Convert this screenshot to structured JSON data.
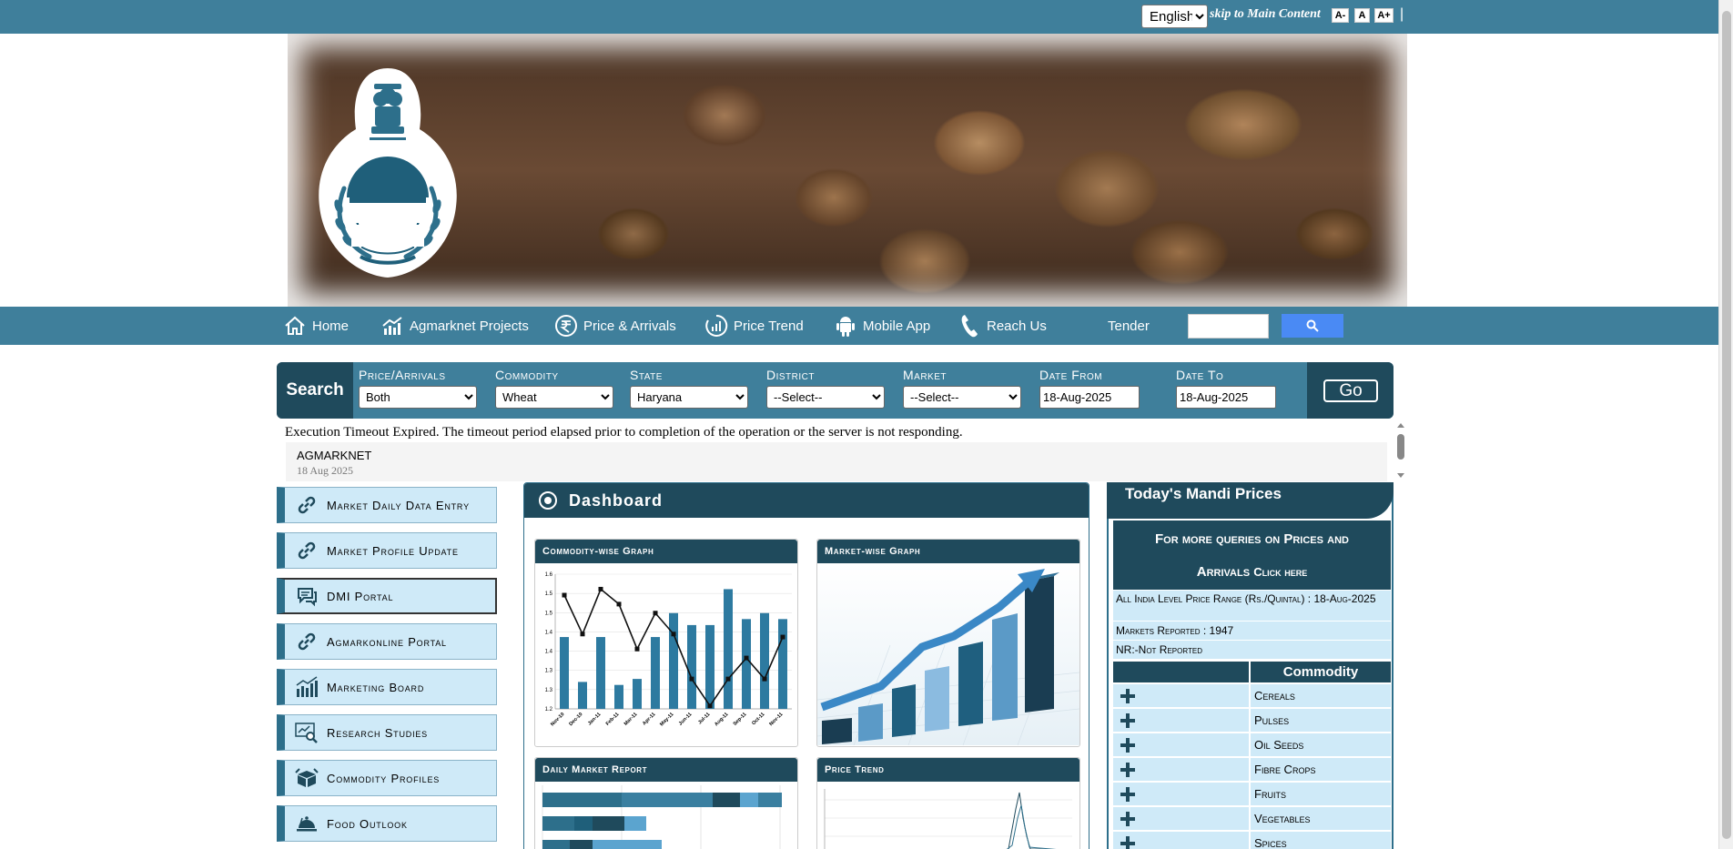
{
  "topbar": {
    "language": "English",
    "skip_link": "skip to Main Content",
    "font_small": "A-",
    "font_normal": "A",
    "font_large": "A+",
    "separator": "|"
  },
  "nav": {
    "items": [
      {
        "label": "Home",
        "icon": "home-icon"
      },
      {
        "label": "Agmarknet Projects",
        "icon": "chart-trend-icon"
      },
      {
        "label": "Price & Arrivals",
        "icon": "rupee-icon"
      },
      {
        "label": "Price Trend",
        "icon": "bar-circle-icon"
      },
      {
        "label": "Mobile App",
        "icon": "android-icon"
      },
      {
        "label": "Reach Us",
        "icon": "phone-icon"
      },
      {
        "label": "Tender",
        "icon": ""
      }
    ],
    "search_placeholder": ""
  },
  "search": {
    "label": "Search",
    "fields": {
      "price_arrivals": {
        "label": "Price/Arrivals",
        "value": "Both"
      },
      "commodity": {
        "label": "Commodity",
        "value": "Wheat"
      },
      "state": {
        "label": "State",
        "value": "Haryana"
      },
      "district": {
        "label": "District",
        "value": "--Select--"
      },
      "market": {
        "label": "Market",
        "value": "--Select--"
      },
      "date_from": {
        "label": "Date From",
        "value": "18-Aug-2025"
      },
      "date_to": {
        "label": "Date To",
        "value": "18-Aug-2025"
      }
    },
    "go": "Go"
  },
  "error_message": "Execution Timeout Expired. The timeout period elapsed prior to completion of the operation or the server is not responding.",
  "news": {
    "title": "AGMARKNET",
    "date": "18 Aug 2025"
  },
  "left_menu": [
    {
      "label": "Market Daily Data Entry",
      "icon": "link-icon"
    },
    {
      "label": "Market Profile Update",
      "icon": "link-icon"
    },
    {
      "label": "DMI Portal",
      "icon": "chat-icon"
    },
    {
      "label": "Agmarkonline Portal",
      "icon": "link-icon"
    },
    {
      "label": "Marketing Board",
      "icon": "bar-chart-icon"
    },
    {
      "label": "Research Studies",
      "icon": "magnifier-chart-icon"
    },
    {
      "label": "Commodity Profiles",
      "icon": "box-icon"
    },
    {
      "label": "Food Outlook",
      "icon": "food-cloche-icon"
    }
  ],
  "dashboard": {
    "title": "Dashboard",
    "panels": {
      "commodity_graph": "Commodity-wise Graph",
      "market_graph": "Market-wise Graph",
      "daily_report": "Daily Market Report",
      "price_trend": "Price Trend"
    }
  },
  "chart_data": {
    "type": "bar",
    "categories": [
      "Nov-10",
      "Dec-10",
      "Jan-11",
      "Feb-11",
      "Mar-11",
      "Apr-11",
      "May-11",
      "Jun-11",
      "Jul-11",
      "Aug-11",
      "Sep-11",
      "Oct-11",
      "Nov-11"
    ],
    "series": [
      {
        "type": "bar",
        "values": [
          1.44,
          1.29,
          1.44,
          1.28,
          1.3,
          1.44,
          1.52,
          1.48,
          1.48,
          1.6,
          1.5,
          1.52,
          1.5
        ]
      },
      {
        "type": "line",
        "values": [
          1.58,
          1.45,
          1.6,
          1.55,
          1.4,
          1.52,
          1.45,
          1.3,
          1.21,
          1.3,
          1.37,
          1.3,
          1.44
        ]
      }
    ],
    "yticks": [
      "1.6",
      "1.5",
      "1.5",
      "1.4",
      "1.4",
      "1.3",
      "1.3",
      "1.2"
    ],
    "ylim": [
      1.2,
      1.65
    ]
  },
  "mandi": {
    "title": "Today's Mandi Prices",
    "queries_line1": "For more queries on Prices and",
    "queries_line2": "Arrivals",
    "click_here": "Click here",
    "price_range": "All India Level Price Range (Rs./Quintal) : 18-Aug-2025",
    "markets_reported": "Markets Reported : 1947",
    "nr": "NR:-Not Reported",
    "commodity_header": "Commodity",
    "commodities": [
      "Cereals",
      "Pulses",
      "Oil Seeds",
      "Fibre Crops",
      "Fruits",
      "Vegetables",
      "Spices"
    ]
  }
}
